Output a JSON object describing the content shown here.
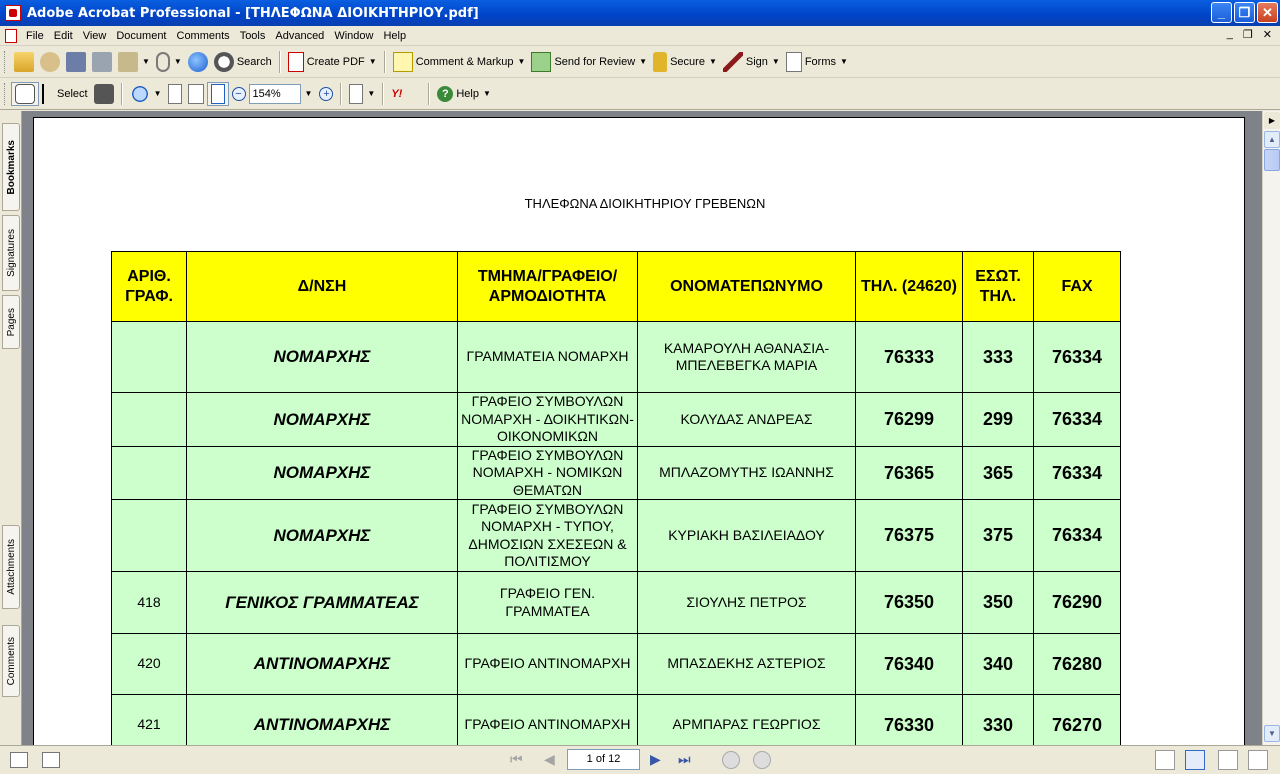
{
  "window": {
    "title": "Adobe Acrobat Professional - [ΤΗΛΕΦΩΝΑ ΔΙΟΙΚΗΤΗΡΙΟΥ.pdf]",
    "minimize": "_",
    "restore": "❐",
    "close": "✕"
  },
  "menu": {
    "items": [
      "File",
      "Edit",
      "View",
      "Document",
      "Comments",
      "Tools",
      "Advanced",
      "Window",
      "Help"
    ],
    "mdi_minimize": "_",
    "mdi_restore": "❐",
    "mdi_close": "✕"
  },
  "toolbar1": {
    "search_label": "Search",
    "create_pdf_label": "Create PDF",
    "comment_label": "Comment & Markup",
    "review_label": "Send for Review",
    "secure_label": "Secure",
    "sign_label": "Sign",
    "forms_label": "Forms"
  },
  "toolbar2": {
    "select_label": "Select",
    "zoom_value": "154%",
    "help_label": "Help",
    "yahoo_label": "Y!"
  },
  "navtabs": [
    "Bookmarks",
    "Signatures",
    "Pages",
    "Attachments",
    "Comments"
  ],
  "document": {
    "heading": "ΤΗΛΕΦΩΝΑ ΔΙΟΙΚΗΤΗΡΙΟΥ ΓΡΕΒΕΝΩΝ",
    "columns": [
      "ΑΡΙΘ. ΓΡΑΦ.",
      "Δ/ΝΣΗ",
      "ΤΜΗΜΑ/ΓΡΑΦΕΙΟ/ ΑΡΜΟΔΙΟΤΗΤΑ",
      "ΟΝΟΜΑΤΕΠΩΝΥΜΟ",
      "ΤΗΛ. (24620)",
      "ΕΣΩΤ. ΤΗΛ.",
      "FAX"
    ],
    "rows": [
      {
        "office": "",
        "dept": "ΝΟΜΑΡΧΗΣ",
        "section": "ΓΡΑΜΜΑΤΕΙΑ ΝΟΜΑΡΧΗ",
        "name": "ΚΑΜΑΡΟΥΛΗ ΑΘΑΝΑΣΙΑ-ΜΠΕΛΕΒΕΓΚΑ ΜΑΡΙΑ",
        "phone": "76333",
        "ext": "333",
        "fax": "76334"
      },
      {
        "office": "",
        "dept": "ΝΟΜΑΡΧΗΣ",
        "section": "ΓΡΑΦΕΙΟ ΣΥΜΒΟΥΛΩΝ ΝΟΜΑΡΧΗ - ΔΟΙΚΗΤΙΚΩΝ-ΟΙΚΟΝΟΜΙΚΩΝ",
        "name": "ΚΟΛΥΔΑΣ ΑΝΔΡΕΑΣ",
        "phone": "76299",
        "ext": "299",
        "fax": "76334"
      },
      {
        "office": "",
        "dept": "ΝΟΜΑΡΧΗΣ",
        "section": "ΓΡΑΦΕΙΟ ΣΥΜΒΟΥΛΩΝ ΝΟΜΑΡΧΗ - ΝΟΜΙΚΩΝ ΘΕΜΑΤΩΝ",
        "name": "ΜΠΛΑΖΟΜΥΤΗΣ ΙΩΑΝΝΗΣ",
        "phone": "76365",
        "ext": "365",
        "fax": "76334"
      },
      {
        "office": "",
        "dept": "ΝΟΜΑΡΧΗΣ",
        "section": "ΓΡΑΦΕΙΟ ΣΥΜΒΟΥΛΩΝ ΝΟΜΑΡΧΗ - ΤΥΠΟΥ, ΔΗΜΟΣΙΩΝ ΣΧΕΣΕΩΝ & ΠΟΛΙΤΙΣΜΟΥ",
        "name": "ΚΥΡΙΑΚΗ ΒΑΣΙΛΕΙΑΔΟΥ",
        "phone": "76375",
        "ext": "375",
        "fax": "76334"
      },
      {
        "office": "418",
        "dept": "ΓΕΝΙΚΟΣ ΓΡΑΜΜΑΤΕΑΣ",
        "section": "ΓΡΑΦΕΙΟ ΓΕΝ. ΓΡΑΜΜΑΤΕΑ",
        "name": "ΣΙΟΥΛΗΣ ΠΕΤΡΟΣ",
        "phone": "76350",
        "ext": "350",
        "fax": "76290"
      },
      {
        "office": "420",
        "dept": "ΑΝΤΙΝΟΜΑΡΧΗΣ",
        "section": "ΓΡΑΦΕΙΟ ΑΝΤΙΝΟΜΑΡΧΗ",
        "name": "ΜΠΑΣΔΕΚΗΣ ΑΣΤΕΡΙΟΣ",
        "phone": "76340",
        "ext": "340",
        "fax": "76280"
      },
      {
        "office": "421",
        "dept": "ΑΝΤΙΝΟΜΑΡΧΗΣ",
        "section": "ΓΡΑΦΕΙΟ ΑΝΤΙΝΟΜΑΡΧΗ",
        "name": "ΑΡΜΠΑΡΑΣ ΓΕΩΡΓΙΟΣ",
        "phone": "76330",
        "ext": "330",
        "fax": "76270"
      }
    ]
  },
  "statusbar": {
    "page_indicator": "1 of 12"
  },
  "colors": {
    "header_bg": "#ffff00",
    "cell_bg": "#ccffcc",
    "title_bar": "#0a5fe0"
  }
}
